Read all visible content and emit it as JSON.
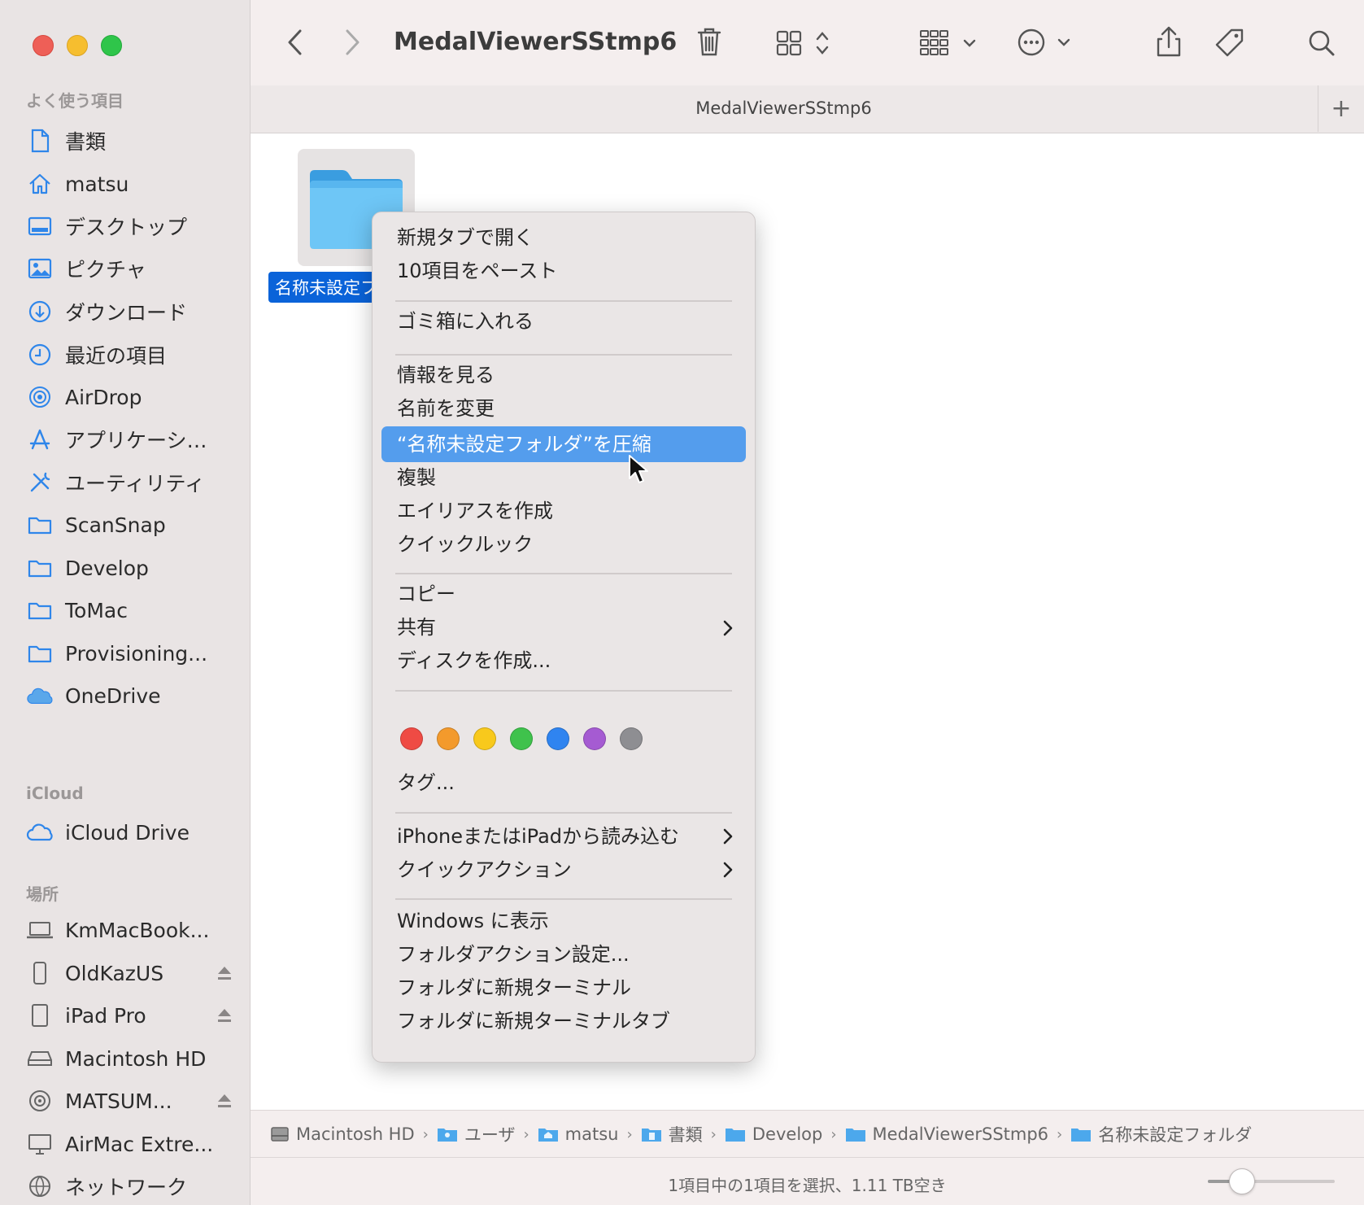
{
  "window": {
    "title": "MedalViewerSStmp6"
  },
  "sidebar": {
    "sections": {
      "favorites": "よく使う項目",
      "icloud": "iCloud",
      "locations": "場所"
    },
    "favorites": [
      {
        "label": "書類",
        "icon": "document-icon"
      },
      {
        "label": "matsu",
        "icon": "home-icon"
      },
      {
        "label": "デスクトップ",
        "icon": "desktop-icon"
      },
      {
        "label": "ピクチャ",
        "icon": "picture-icon"
      },
      {
        "label": "ダウンロード",
        "icon": "download-icon"
      },
      {
        "label": "最近の項目",
        "icon": "clock-icon"
      },
      {
        "label": "AirDrop",
        "icon": "airdrop-icon"
      },
      {
        "label": "アプリケーシ…",
        "icon": "applications-icon"
      },
      {
        "label": "ユーティリティ",
        "icon": "utilities-icon"
      },
      {
        "label": "ScanSnap",
        "icon": "folder-icon"
      },
      {
        "label": "Develop",
        "icon": "folder-icon"
      },
      {
        "label": "ToMac",
        "icon": "folder-icon"
      },
      {
        "label": "Provisioning...",
        "icon": "folder-icon"
      },
      {
        "label": "OneDrive",
        "icon": "onedrive-icon"
      }
    ],
    "icloud": [
      {
        "label": "iCloud Drive",
        "icon": "icloud-icon"
      }
    ],
    "locations": [
      {
        "label": "KmMacBook...",
        "icon": "laptop-icon"
      },
      {
        "label": "OldKazUS",
        "icon": "phone-icon"
      },
      {
        "label": "iPad Pro",
        "icon": "ipad-icon"
      },
      {
        "label": "Macintosh HD",
        "icon": "harddisk-icon"
      },
      {
        "label": "MATSUM...",
        "icon": "disc-icon"
      },
      {
        "label": "AirMac Extre...",
        "icon": "display-icon"
      },
      {
        "label": "ネットワーク",
        "icon": "network-icon"
      }
    ]
  },
  "tab": {
    "title": "MedalViewerSStmp6"
  },
  "file": {
    "name": "名称未設定フ"
  },
  "context_menu": {
    "items": {
      "open_new_tab": "新規タブで開く",
      "paste": "10項目をペースト",
      "trash": "ゴミ箱に入れる",
      "get_info": "情報を見る",
      "rename": "名前を変更",
      "compress": "“名称未設定フォルダ”を圧縮",
      "duplicate": "複製",
      "make_alias": "エイリアスを作成",
      "quick_look": "クイックルック",
      "copy": "コピー",
      "share": "共有",
      "make_disk": "ディスクを作成...",
      "tags": "タグ...",
      "import_iphone": "iPhoneまたはiPadから読み込む",
      "quick_actions": "クイックアクション",
      "show_windows": "Windows に表示",
      "folder_actions": "フォルダアクション設定...",
      "new_terminal": "フォルダに新規ターミナル",
      "new_terminal_tab": "フォルダに新規ターミナルタブ"
    },
    "tag_colors": [
      "#ef4b44",
      "#f39a2c",
      "#f8c91c",
      "#3fc24c",
      "#2f84f0",
      "#a55bd2",
      "#8e8e92"
    ]
  },
  "pathbar": [
    {
      "label": "Macintosh HD",
      "icon": "harddisk-icon"
    },
    {
      "label": "ユーザ",
      "icon": "users-folder-icon"
    },
    {
      "label": "matsu",
      "icon": "home-folder-icon"
    },
    {
      "label": "書類",
      "icon": "documents-folder-icon"
    },
    {
      "label": "Develop",
      "icon": "folder-icon"
    },
    {
      "label": "MedalViewerSStmp6",
      "icon": "folder-icon"
    },
    {
      "label": "名称未設定フォルダ",
      "icon": "folder-icon"
    }
  ],
  "status": {
    "text": "1項目中の1項目を選択、1.11 TB空き",
    "zoom_fraction": 0.26
  }
}
